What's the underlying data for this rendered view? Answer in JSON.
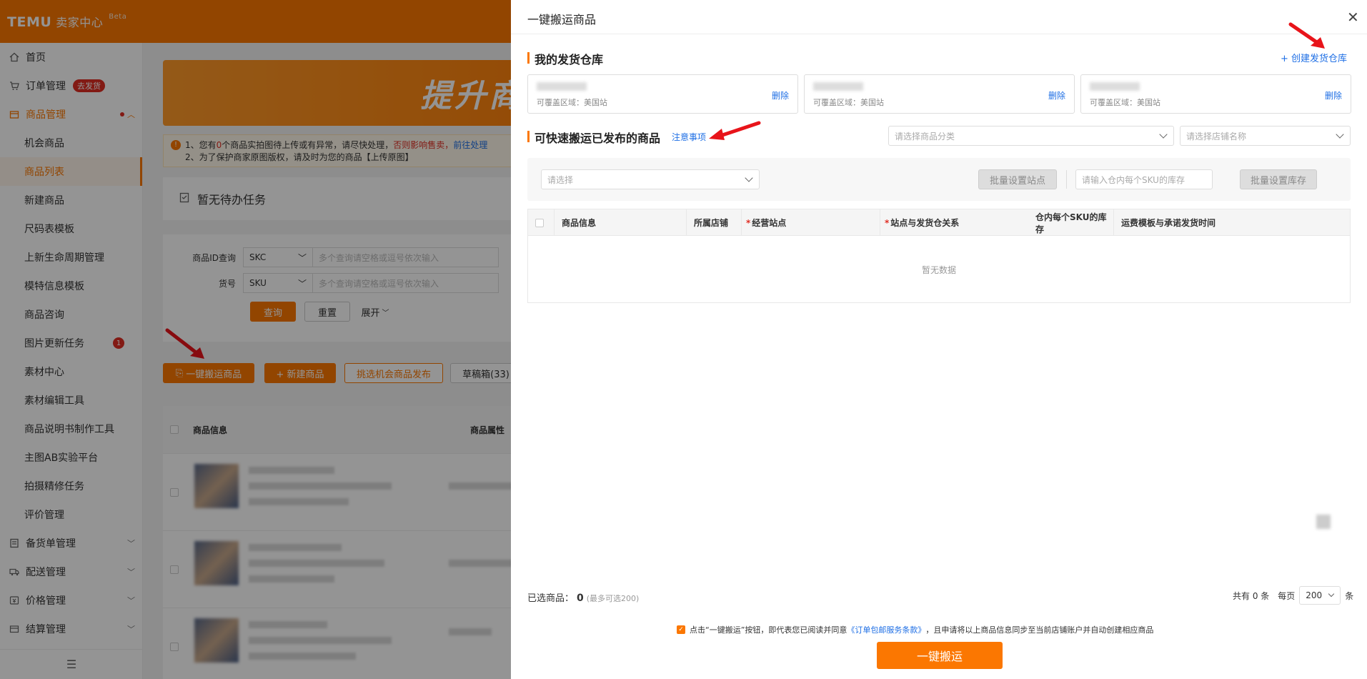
{
  "app": {
    "logo": "TEMU",
    "name": "卖家中心",
    "beta": "Beta"
  },
  "sidebar": {
    "items": [
      {
        "label": "首页",
        "icon": "home-icon"
      },
      {
        "label": "订单管理",
        "icon": "cart-icon",
        "badge": "去发货"
      },
      {
        "label": "商品管理",
        "icon": "box-icon"
      },
      {
        "label": "机会商品"
      },
      {
        "label": "商品列表"
      },
      {
        "label": "新建商品"
      },
      {
        "label": "尺码表模板"
      },
      {
        "label": "上新生命周期管理"
      },
      {
        "label": "模特信息模板"
      },
      {
        "label": "商品咨询"
      },
      {
        "label": "图片更新任务",
        "badge": "1"
      },
      {
        "label": "素材中心"
      },
      {
        "label": "素材编辑工具"
      },
      {
        "label": "商品说明书制作工具"
      },
      {
        "label": "主图AB实验平台"
      },
      {
        "label": "拍摄精修任务"
      },
      {
        "label": "评价管理"
      },
      {
        "label": "备货单管理",
        "icon": "doc-icon"
      },
      {
        "label": "配送管理",
        "icon": "truck-icon"
      },
      {
        "label": "价格管理",
        "icon": "price-icon"
      },
      {
        "label": "结算管理",
        "icon": "wallet-icon"
      }
    ]
  },
  "background": {
    "banner": "提升商",
    "notice_line1_a": "1、您有",
    "notice_count": "0",
    "notice_line1_b": "个商品实拍图待上传或有异常，请尽快处理，",
    "notice_warn": "否则影响售卖，",
    "notice_link": "前往处理",
    "notice_line2": "2、为了保护商家原图版权，请及时为您的商品【上传原图】",
    "todo": "暂无待办任务",
    "filter1_label": "商品ID查询",
    "filter1_sel": "SKC",
    "filter1_placeholder": "多个查询请空格或逗号依次输入",
    "filter2_label": "货号",
    "filter2_sel": "SKU",
    "filter2_placeholder": "多个查询请空格或逗号依次输入",
    "query": "查询",
    "reset": "重置",
    "expand": "展开",
    "btn_move": "一键搬运商品",
    "btn_new": "+ 新建商品",
    "btn_pick": "挑选机会商品发布",
    "btn_draft": "草稿箱(33)",
    "col_info": "商品信息",
    "col_attr": "商品属性"
  },
  "drawer": {
    "title": "一键搬运商品",
    "warehouse_title": "我的发货仓库",
    "create_warehouse": "+ 创建发货仓库",
    "warehouses": [
      {
        "region": "可覆盖区域：美国站",
        "delete": "删除"
      },
      {
        "region": "可覆盖区域：美国站",
        "delete": "删除"
      },
      {
        "region": "可覆盖区域：美国站",
        "delete": "删除"
      }
    ],
    "products_title": "可快速搬运已发布的商品",
    "notes_link": "注意事项",
    "category_placeholder": "请选择商品分类",
    "store_placeholder": "请选择店铺名称",
    "site_placeholder": "请选择",
    "batch_site": "批量设置站点",
    "stock_placeholder": "请输入仓内每个SKU的库存",
    "batch_stock": "批量设置库存",
    "columns": {
      "info": "商品信息",
      "store": "所属店铺",
      "site": "经营站点",
      "relation": "站点与发货仓关系",
      "stock": "仓内每个SKU的库存",
      "shipping": "运费模板与承诺发货时间"
    },
    "empty": "暂无数据",
    "selected_label": "已选商品：",
    "selected_count": "0",
    "selected_hint": "(最多可选200)",
    "total_text": "共有 0 条",
    "per_page_label": "每页",
    "per_page": "200",
    "per_page_unit": "条",
    "agree_a": "点击“一键搬运”按钮，即代表您已阅读并同意",
    "agree_link": "《订单包邮服务条款》",
    "agree_b": "，且申请将以上商品信息同步至当前店铺账户并自动创建相应商品",
    "submit": "一键搬运"
  },
  "colors": {
    "brand": "#fb7701",
    "link": "#1f6fe5",
    "danger": "#e02e24",
    "arrow": "#e8141a"
  }
}
